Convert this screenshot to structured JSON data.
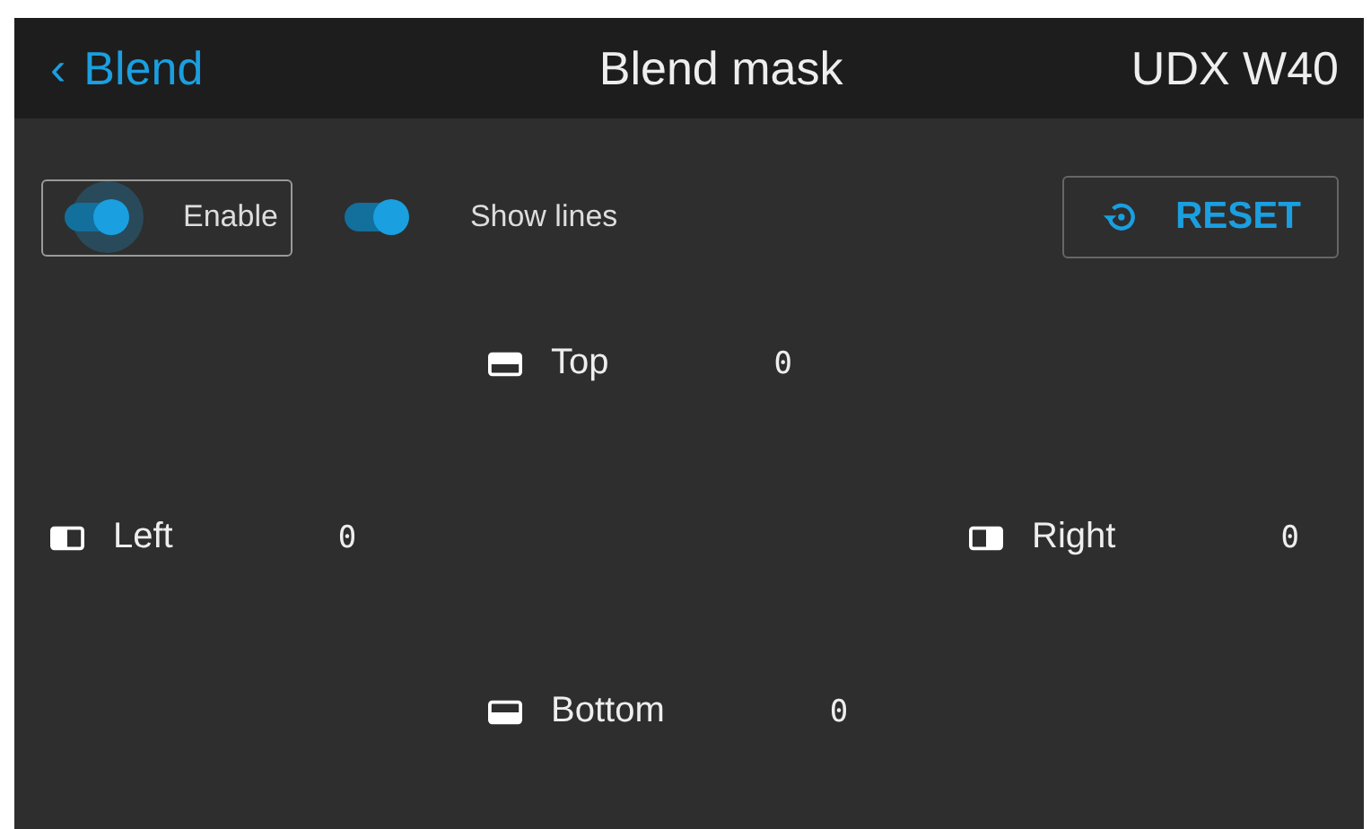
{
  "header": {
    "back": "‹",
    "back_label": "Blend",
    "title": "Blend mask",
    "device": "UDX W40"
  },
  "toggles": [
    {
      "label": "Enable",
      "on": true,
      "focused": true
    },
    {
      "label": "Show lines",
      "on": true,
      "focused": false
    }
  ],
  "reset": {
    "label": "RESET"
  },
  "edges": [
    {
      "kind": "top",
      "label": "Top",
      "value": "0"
    },
    {
      "kind": "left",
      "label": "Left",
      "value": "0"
    },
    {
      "kind": "right",
      "label": "Right",
      "value": "0"
    },
    {
      "kind": "bottom",
      "label": "Bottom",
      "value": "0"
    }
  ]
}
